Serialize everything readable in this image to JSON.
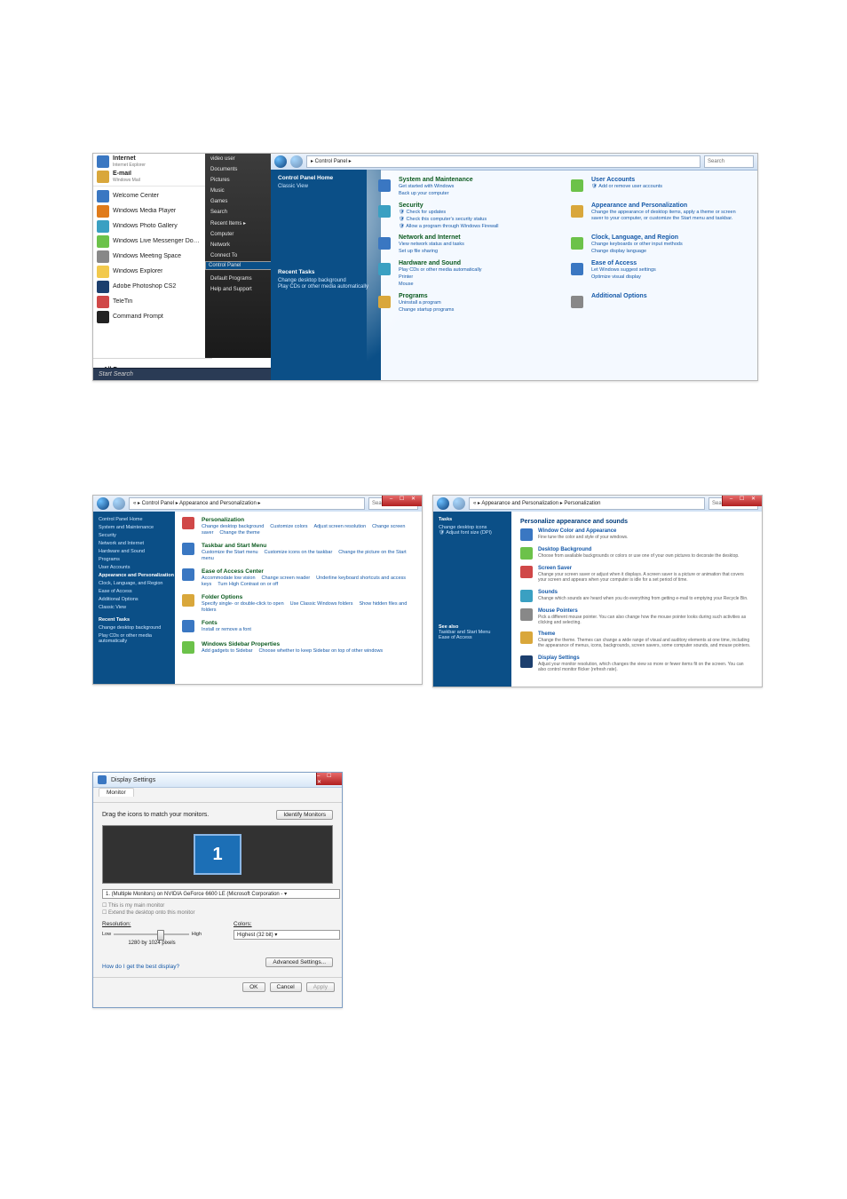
{
  "img1": {
    "start_menu": {
      "left": [
        {
          "icon": "globe",
          "bold": true,
          "label": "Internet",
          "sub": "Internet Explorer"
        },
        {
          "icon": "mail",
          "bold": true,
          "label": "E-mail",
          "sub": "Windows Mail"
        },
        {
          "icon": "flag",
          "label": "Welcome Center"
        },
        {
          "icon": "wmp",
          "label": "Windows Media Player"
        },
        {
          "icon": "photo",
          "label": "Windows Photo Gallery"
        },
        {
          "icon": "msn",
          "label": "Windows Live Messenger Download"
        },
        {
          "icon": "meeting",
          "label": "Windows Meeting Space"
        },
        {
          "icon": "ie",
          "label": "Windows Explorer"
        },
        {
          "icon": "ps",
          "label": "Adobe Photoshop CS2"
        },
        {
          "icon": "teletin",
          "label": "TeleTin"
        },
        {
          "icon": "cmd",
          "label": "Command Prompt"
        }
      ],
      "all_programs": "All Programs",
      "search_placeholder": "Start Search",
      "right": [
        "video user",
        "Documents",
        "Pictures",
        "Music",
        "Games",
        "Search",
        "Recent Items  ▸",
        "Computer",
        "Network",
        "Connect To",
        "Control Panel",
        "Default Programs",
        "Help and Support"
      ],
      "right_selected": "Control Panel"
    },
    "cp_home": {
      "breadcrumb": "▸ Control Panel ▸",
      "search_placeholder": "Search",
      "side": {
        "title": "Control Panel Home",
        "classic": "Classic View",
        "recent_title": "Recent Tasks",
        "recent": [
          "Change desktop background",
          "Play CDs or other media automatically"
        ]
      },
      "cats": [
        {
          "k": "sys",
          "title": "System and Maintenance",
          "links": [
            "Get started with Windows",
            "Back up your computer"
          ]
        },
        {
          "k": "usr",
          "title": "User Accounts",
          "links": [
            "Add or remove user accounts"
          ],
          "shield": true
        },
        {
          "k": "sec",
          "title": "Security",
          "links": [
            "Check for updates",
            "Check this computer's security status",
            "Allow a program through Windows Firewall"
          ],
          "shield": true
        },
        {
          "k": "appr",
          "title": "Appearance and Personalization",
          "links": [
            "Change the appearance of desktop items, apply a theme or screen saver to your computer, or customize the Start menu and taskbar."
          ],
          "desc": true
        },
        {
          "k": "net",
          "title": "Network and Internet",
          "links": [
            "View network status and tasks",
            "Set up file sharing"
          ]
        },
        {
          "k": "clk",
          "title": "Clock, Language, and Region",
          "links": [
            "Change keyboards or other input methods",
            "Change display language"
          ]
        },
        {
          "k": "hw",
          "title": "Hardware and Sound",
          "links": [
            "Play CDs or other media automatically",
            "Printer",
            "Mouse"
          ]
        },
        {
          "k": "ease",
          "title": "Ease of Access",
          "links": [
            "Let Windows suggest settings",
            "Optimize visual display"
          ]
        },
        {
          "k": "prog",
          "title": "Programs",
          "links": [
            "Uninstall a program",
            "Change startup programs"
          ]
        },
        {
          "k": "addl",
          "title": "Additional Options",
          "links": []
        }
      ]
    }
  },
  "img2": {
    "breadcrumb": "« ▸ Control Panel ▸ Appearance and Personalization ▸",
    "search_placeholder": "Search",
    "side": [
      "Control Panel Home",
      "System and Maintenance",
      "Security",
      "Network and Internet",
      "Hardware and Sound",
      "Programs",
      "User Accounts",
      "Appearance and Personalization",
      "Clock, Language, and Region",
      "Ease of Access",
      "Additional Options",
      "",
      "Classic View"
    ],
    "side_current": "Appearance and Personalization",
    "recent_title": "Recent Tasks",
    "recent": [
      "Change desktop background",
      "Play CDs or other media automatically"
    ],
    "items": [
      {
        "ic": "pers",
        "title": "Personalization",
        "links": [
          "Change desktop background",
          "Customize colors",
          "Adjust screen resolution",
          "Change screen saver",
          "Change the theme"
        ]
      },
      {
        "ic": "task",
        "title": "Taskbar and Start Menu",
        "links": [
          "Customize the Start menu",
          "Customize icons on the taskbar",
          "Change the picture on the Start menu"
        ]
      },
      {
        "ic": "ease",
        "title": "Ease of Access Center",
        "links": [
          "Accommodate low vision",
          "Change screen reader",
          "Underline keyboard shortcuts and access keys",
          "Turn High Contrast on or off"
        ]
      },
      {
        "ic": "fold",
        "title": "Folder Options",
        "links": [
          "Specify single- or double-click to open",
          "Use Classic Windows folders",
          "Show hidden files and folders"
        ]
      },
      {
        "ic": "font",
        "title": "Fonts",
        "links": [
          "Install or remove a font"
        ]
      },
      {
        "ic": "side",
        "title": "Windows Sidebar Properties",
        "links": [
          "Add gadgets to Sidebar",
          "Choose whether to keep Sidebar on top of other windows"
        ]
      }
    ]
  },
  "img3": {
    "breadcrumb": "« ▸ Appearance and Personalization ▸ Personalization",
    "search_placeholder": "Search",
    "side": {
      "tasks": "Tasks",
      "items": [
        "Change desktop icons",
        "Adjust font size (DPI)"
      ],
      "see_also": "See also",
      "sa": [
        "Taskbar and Start Menu",
        "Ease of Access"
      ]
    },
    "heading": "Personalize appearance and sounds",
    "items": [
      {
        "ic": "wca",
        "title": "Window Color and Appearance",
        "desc": "Fine tune the color and style of your windows."
      },
      {
        "ic": "bg",
        "title": "Desktop Background",
        "desc": "Choose from available backgrounds or colors or use one of your own pictures to decorate the desktop."
      },
      {
        "ic": "ss",
        "title": "Screen Saver",
        "desc": "Change your screen saver or adjust when it displays. A screen saver is a picture or animation that covers your screen and appears when your computer is idle for a set period of time."
      },
      {
        "ic": "snd",
        "title": "Sounds",
        "desc": "Change which sounds are heard when you do everything from getting e-mail to emptying your Recycle Bin."
      },
      {
        "ic": "ptr",
        "title": "Mouse Pointers",
        "desc": "Pick a different mouse pointer. You can also change how the mouse pointer looks during such activities as clicking and selecting."
      },
      {
        "ic": "thm",
        "title": "Theme",
        "desc": "Change the theme. Themes can change a wide range of visual and auditory elements at one time, including the appearance of menus, icons, backgrounds, screen savers, some computer sounds, and mouse pointers."
      },
      {
        "ic": "disp",
        "title": "Display Settings",
        "desc": "Adjust your monitor resolution, which changes the view so more or fewer items fit on the screen. You can also control monitor flicker (refresh rate)."
      }
    ]
  },
  "img4": {
    "title": "Display Settings",
    "tab": "Monitor",
    "drag": "Drag the icons to match your monitors.",
    "identify": "Identify Monitors",
    "monitor_num": "1",
    "select": "1. (Multiple Monitors) on NVIDIA GeForce 6600 LE (Microsoft Corporation -  ▾",
    "chk_main": "This is my main monitor",
    "chk_ext": "Extend the desktop onto this monitor",
    "res_label": "Resolution:",
    "low": "Low",
    "high": "High",
    "res_value": "1280 by 1024 pixels",
    "col_label": "Colors:",
    "col_value": "Highest (32 bit)   ▾",
    "help": "How do I get the best display?",
    "adv": "Advanced Settings...",
    "ok": "OK",
    "cancel": "Cancel",
    "apply": "Apply"
  }
}
